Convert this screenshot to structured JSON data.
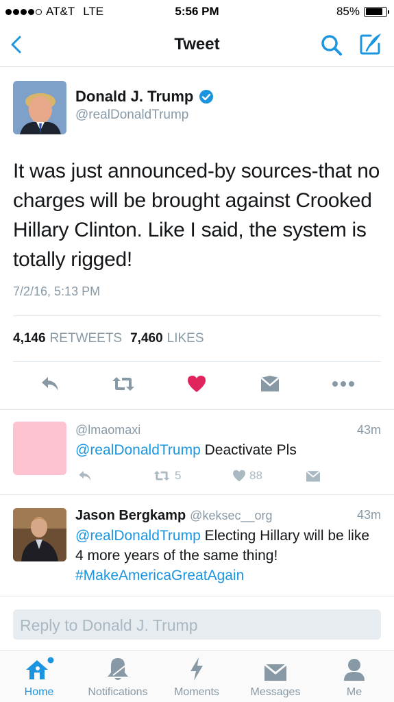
{
  "status_bar": {
    "carrier": "AT&T",
    "network": "LTE",
    "time": "5:56 PM",
    "battery": "85%",
    "battery_level": 0.85
  },
  "nav": {
    "title": "Tweet",
    "back_icon": "chevron-left-icon",
    "search_icon": "search-icon",
    "compose_icon": "compose-icon"
  },
  "tweet": {
    "author_name": "Donald J. Trump",
    "handle": "@realDonaldTrump",
    "verified": true,
    "text": "It was just announced-by sources-that no charges will be brought against Crooked Hillary Clinton. Like I said, the system is totally rigged!",
    "timestamp": "7/2/16, 5:13 PM",
    "retweet_count": "4,146",
    "retweet_label": "RETWEETS",
    "like_count": "7,460",
    "like_label": "LIKES",
    "liked": true
  },
  "replies": [
    {
      "name": "",
      "handle": "@lmaomaxi",
      "ago": "43m",
      "mention": "@realDonaldTrump",
      "text": " Deactivate Pls",
      "hashtag": "",
      "retweets": "5",
      "likes": "88"
    },
    {
      "name": "Jason Bergkamp",
      "handle": "@keksec__org",
      "ago": "43m",
      "mention": "@realDonaldTrump",
      "text": " Electing Hillary will be like 4 more years of the same thing! ",
      "hashtag": "#MakeAmericaGreatAgain"
    }
  ],
  "reply_box": {
    "placeholder": "Reply to Donald J. Trump"
  },
  "tab_bar": {
    "tabs": [
      {
        "label": "Home",
        "icon": "home-icon",
        "active": true
      },
      {
        "label": "Notifications",
        "icon": "bell-icon",
        "active": false
      },
      {
        "label": "Moments",
        "icon": "lightning-icon",
        "active": false
      },
      {
        "label": "Messages",
        "icon": "envelope-icon",
        "active": false
      },
      {
        "label": "Me",
        "icon": "person-icon",
        "active": false
      }
    ]
  },
  "colors": {
    "accent": "#1b95e0",
    "like_red": "#e0245e",
    "muted": "#8899a6",
    "icon_gray": "#aab8c2"
  }
}
